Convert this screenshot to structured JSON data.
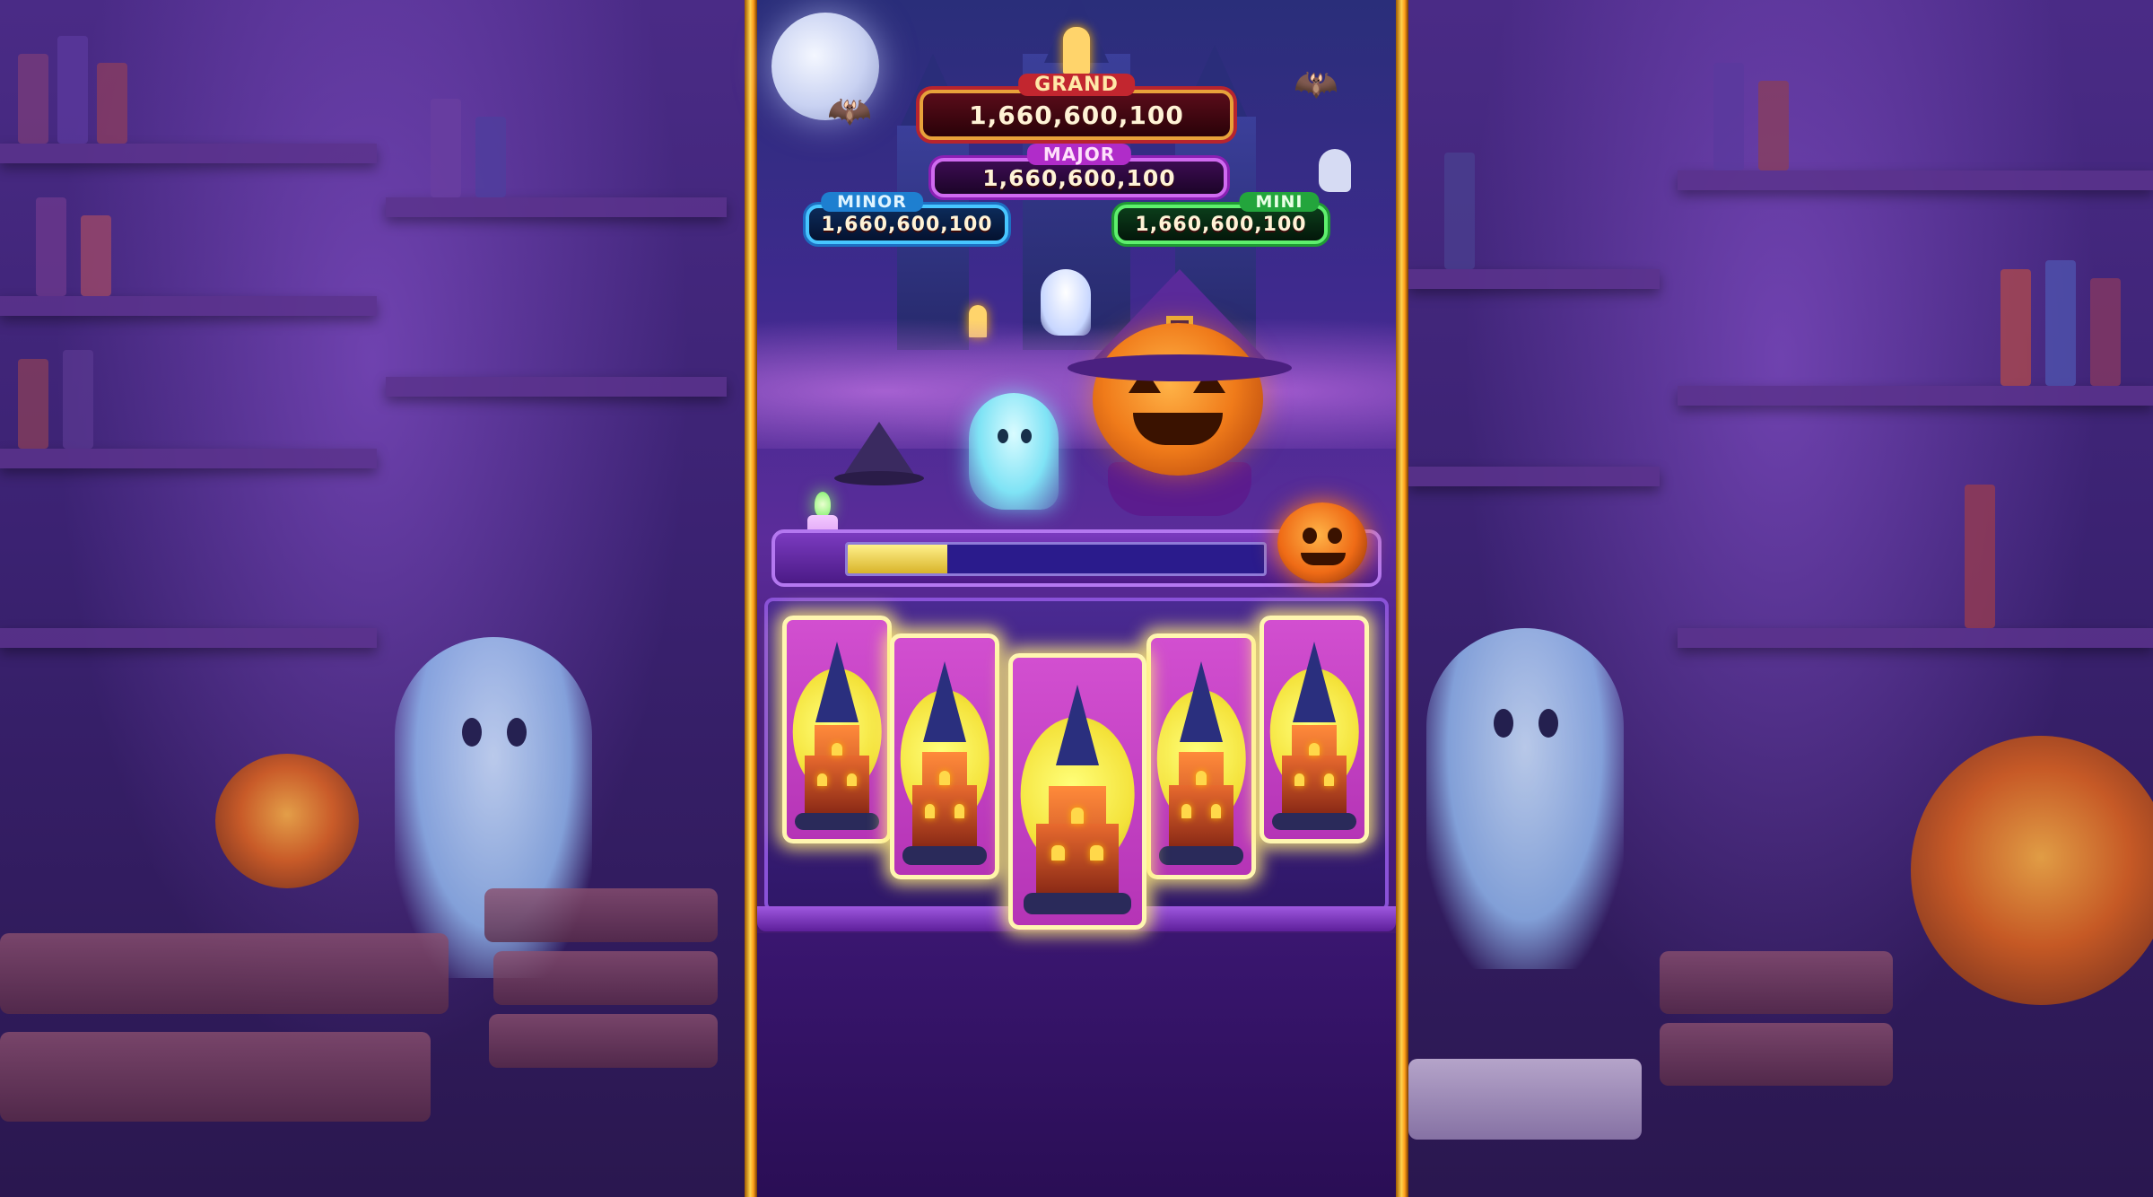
{
  "jackpots": {
    "grand": {
      "label": "GRAND",
      "value": "1,660,600,100"
    },
    "major": {
      "label": "MAJOR",
      "value": "1,660,600,100"
    },
    "minor": {
      "label": "MINOR",
      "value": "1,660,600,100"
    },
    "mini": {
      "label": "MINI",
      "value": "1,660,600,100"
    }
  },
  "progress_meter": {
    "fill_fraction": 0.24
  },
  "reels": {
    "symbols": [
      "castle",
      "castle",
      "castle",
      "castle",
      "castle"
    ],
    "highlighted": true
  },
  "colors": {
    "grand": "#c2262f",
    "major": "#b02cc9",
    "minor": "#1e7fd0",
    "mini": "#23a53c",
    "frame_gold": "#ffd34d"
  }
}
